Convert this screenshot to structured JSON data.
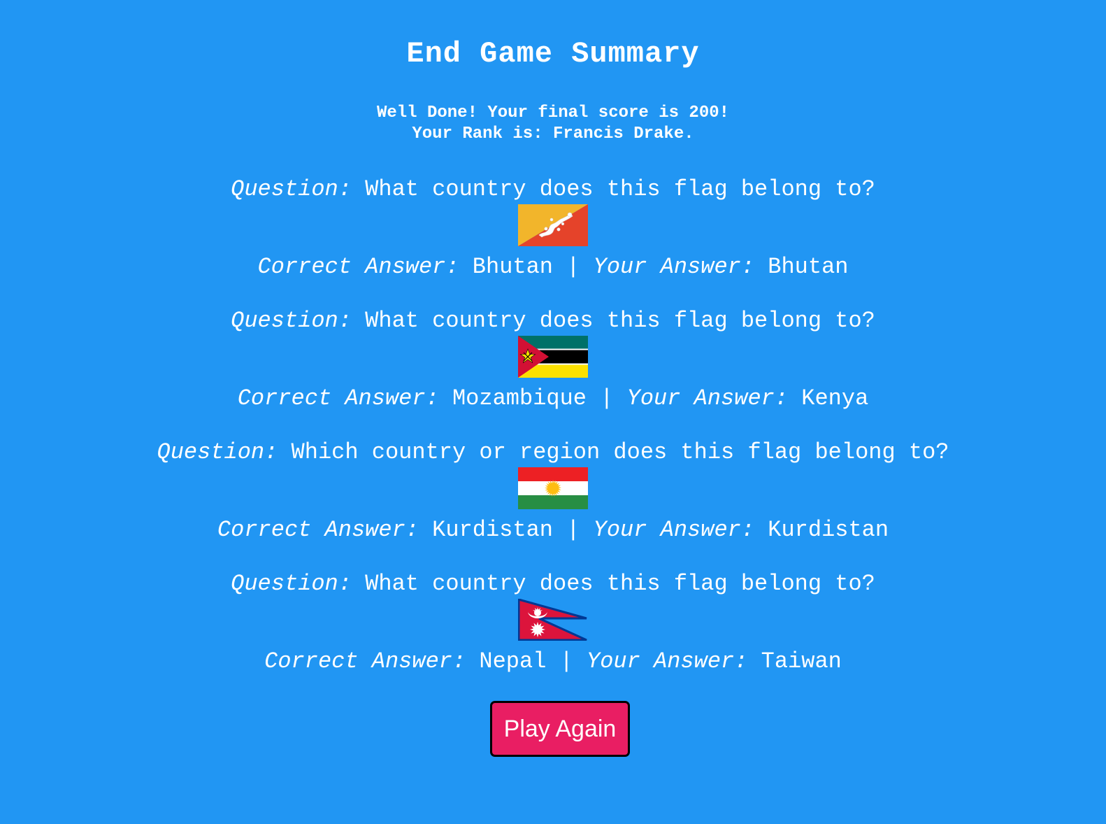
{
  "page": {
    "title": "End Game Summary",
    "score_line": "Well Done! Your final score is 200!",
    "rank_line": "Your Rank is: Francis Drake.",
    "background_color": "#2196f3"
  },
  "labels": {
    "question": "Question:",
    "correct_answer": "Correct Answer:",
    "your_answer": "Your Answer:",
    "separator": "|"
  },
  "questions": [
    {
      "question": "What country does this flag belong to?",
      "flag_icon": "bhutan-flag-icon",
      "correct_answer": "Bhutan",
      "your_answer": "Bhutan"
    },
    {
      "question": "What country does this flag belong to?",
      "flag_icon": "mozambique-flag-icon",
      "correct_answer": "Mozambique",
      "your_answer": "Kenya"
    },
    {
      "question": "Which country or region does this flag belong to?",
      "flag_icon": "kurdistan-flag-icon",
      "correct_answer": "Kurdistan",
      "your_answer": "Kurdistan"
    },
    {
      "question": "What country does this flag belong to?",
      "flag_icon": "nepal-flag-icon",
      "correct_answer": "Nepal",
      "your_answer": "Taiwan"
    }
  ],
  "play_again": {
    "label": "Play Again",
    "color": "#e91e63"
  }
}
